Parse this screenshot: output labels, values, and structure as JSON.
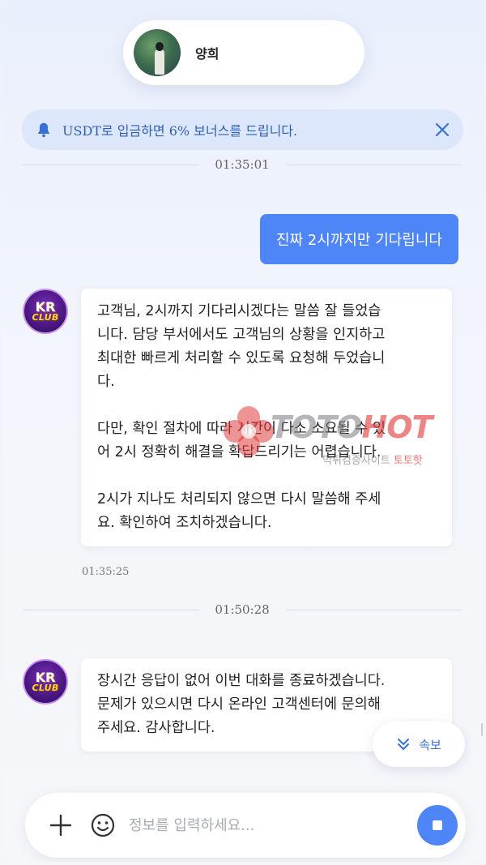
{
  "header": {
    "agent_name": "양희"
  },
  "notice": {
    "text": "USDT로 입금하면 6% 보너스를 드립니다."
  },
  "messages": [
    {
      "type": "time",
      "text": "01:35:01"
    },
    {
      "type": "outgoing",
      "text": "진짜 2시까지만 기다립니다"
    },
    {
      "type": "incoming",
      "sender": {
        "brand_top": "KR",
        "brand_bottom": "CLUB"
      },
      "text": "고객님, 2시까지 기다리시겠다는 말씀 잘 들었습\n니다. 담당 부서에서도 고객님의 상황을 인지하고\n최대한 빠르게 처리할 수 있도록 요청해 두었습니\n다.\n\n다만, 확인 절차에 따라 시간이 다소 소요될 수 있\n어 2시 정확히 해결을 확답드리기는 어렵습니다.\n\n2시가 지나도 처리되지 않으면 다시 말씀해 주세\n요. 확인하여 조치하겠습니다.",
      "time": "01:35:25"
    },
    {
      "type": "time",
      "text": "01:50:28"
    },
    {
      "type": "incoming",
      "sender": {
        "brand_top": "KR",
        "brand_bottom": "CLUB"
      },
      "text": "장시간 응답이 없어 이번 대화를 종료하겠습니다.\n문제가 있으시면 다시 온라인 고객센터에 문의해\n주세요. 감사합니다."
    }
  ],
  "watermark": {
    "brand_part1": "TOTO",
    "brand_part2": "HOT",
    "sub_part1": "먹튀검증사이트 ",
    "sub_part2": "토토핫"
  },
  "urgent_button": {
    "label": "속보"
  },
  "composer": {
    "placeholder": "정보를 입력하세요...",
    "value": ""
  },
  "icons": {
    "notice": "bell-icon",
    "notice_close": "close-icon",
    "composer_add": "plus-icon",
    "composer_emoji": "smiley-icon",
    "send": "stop-square-icon",
    "urgent": "double-chevron-down-icon"
  },
  "colors": {
    "accent": "#4e86f7",
    "notice_bg": "#dde7fb",
    "notice_text": "#2d5fb8"
  }
}
